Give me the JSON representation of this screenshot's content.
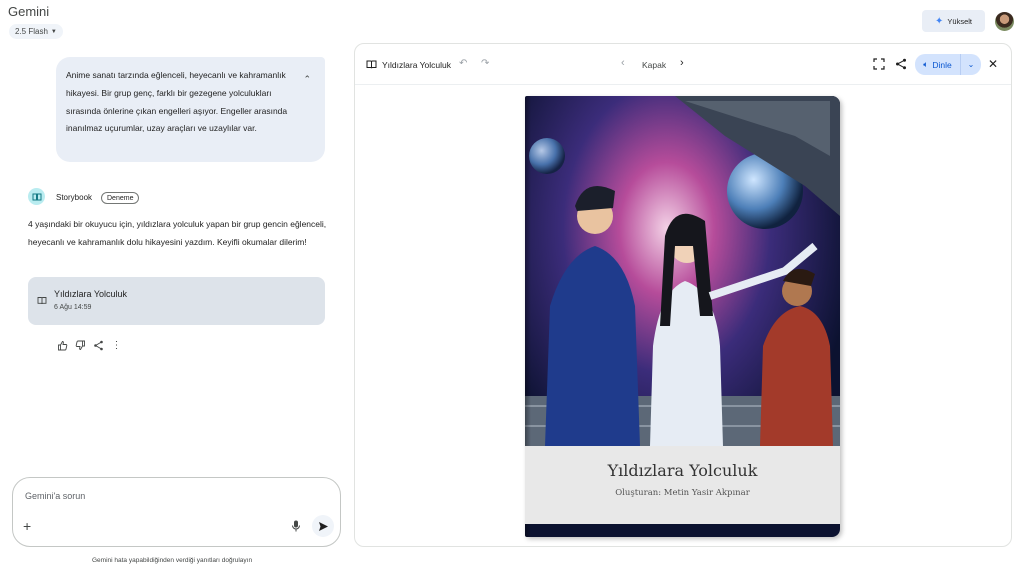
{
  "app": {
    "brand": "Gemini",
    "model": "2.5 Flash",
    "upgrade_label": "Yükselt"
  },
  "chat": {
    "user_prompt": "Anime sanatı tarzında eğlenceli, heyecanlı ve kahramanlık hikayesi. Bir grup genç, farklı bir gezegene yolculukları sırasında önlerine çıkan engelleri aşıyor. Engeller arasında inanılmaz uçurumlar, uzay araçları ve uzaylılar var.",
    "tool_name": "Storybook",
    "tool_badge": "Deneme",
    "response": "4 yaşındaki bir okuyucu için, yıldızlara yolculuk yapan bir grup gencin eğlenceli, heyecanlı ve kahramanlık dolu hikayesini yazdım. Keyifli okumalar dilerim!",
    "story_card": {
      "title": "Yıldızlara Yolculuk",
      "date": "6 Ağu 14:59"
    }
  },
  "input": {
    "placeholder": "Gemini'a sorun",
    "disclaimer": "Gemini hata yapabildiğinden verdiği yanıtları doğrulayın"
  },
  "panel": {
    "title": "Yıldızlara Yolculuk",
    "page_label": "Kapak",
    "listen_label": "Dinle",
    "cover_title": "Yıldızlara Yolculuk",
    "cover_author": "Oluşturan: Metin Yasir Akpınar"
  },
  "icons": {
    "actions": [
      "thumb-up-icon",
      "thumb-down-icon",
      "share-icon",
      "more-icon"
    ]
  },
  "colors": {
    "accent": "#0b57d0",
    "bubble": "#e9eef6",
    "card": "#dde3ea"
  }
}
